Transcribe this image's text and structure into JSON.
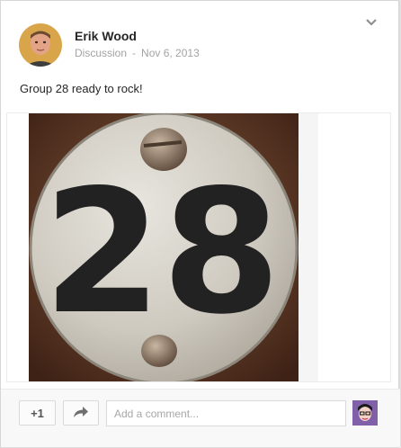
{
  "post": {
    "author": "Erik Wood",
    "category": "Discussion",
    "separator": "-",
    "date": "Nov 6, 2013",
    "text": "Group 28 ready to rock!"
  },
  "photo": {
    "icon": "numbered-tag-photo",
    "number": "28"
  },
  "footer": {
    "plus_one_label": "+1",
    "share_icon": "share-arrow-icon",
    "comment_placeholder": "Add a comment..."
  },
  "colors": {
    "card_bg": "#ffffff",
    "page_bg": "#e5e5e5",
    "text_primary": "#262626",
    "text_muted": "#a3a3a3"
  }
}
